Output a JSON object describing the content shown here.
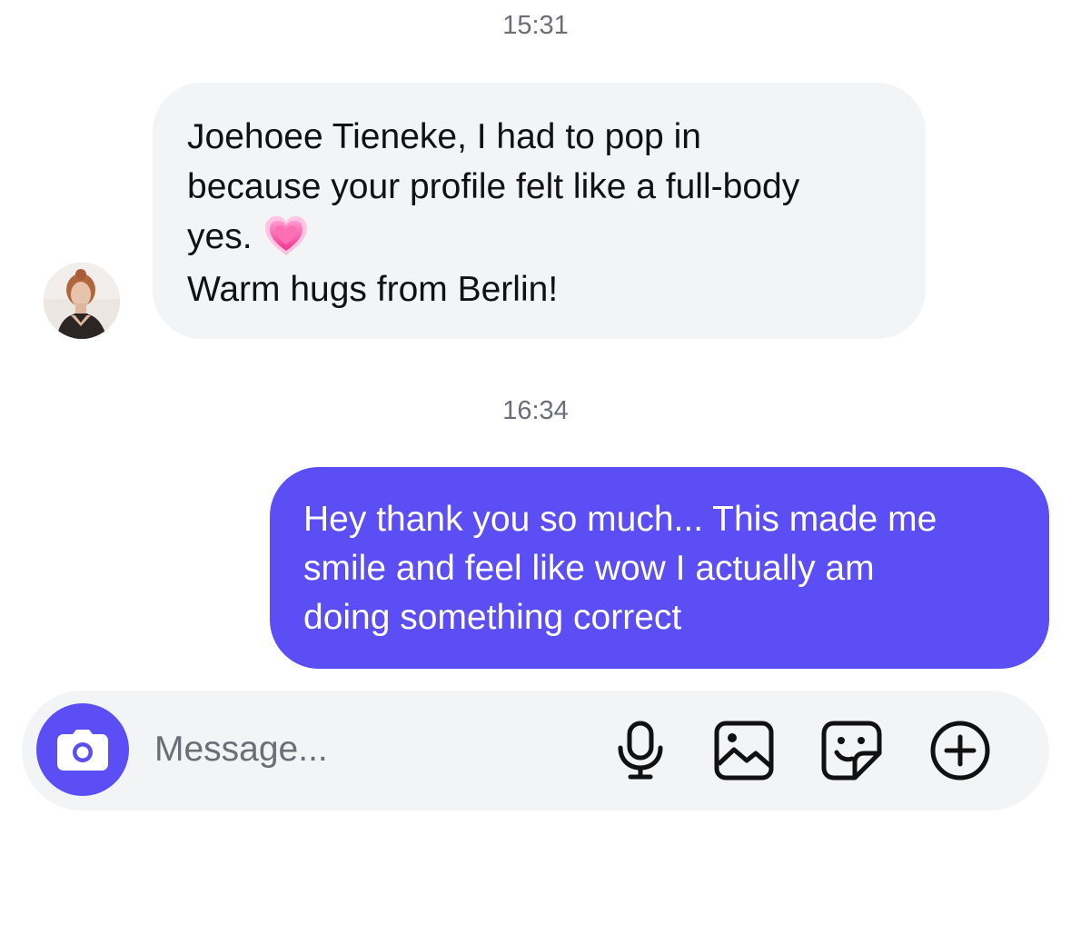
{
  "conversation": {
    "messages": [
      {
        "timestamp": "15:31",
        "direction": "incoming",
        "avatar_icon": "profile-photo-avatar",
        "lines": [
          "Joehoee Tieneke, I had to pop in",
          "because your profile felt like a full-body",
          "yes.",
          "Warm hugs from Berlin!"
        ],
        "emoji": "💗",
        "emoji_icon": "growing-heart-icon"
      },
      {
        "timestamp": "16:34",
        "direction": "outgoing",
        "lines": [
          "Hey thank you so much... This made me",
          "smile and feel like wow I actually am",
          "doing something correct"
        ]
      }
    ]
  },
  "composer": {
    "placeholder": "Message...",
    "value": "",
    "buttons": {
      "camera": "camera-icon",
      "mic": "microphone-icon",
      "gallery": "image-gallery-icon",
      "sticker": "sticker-icon",
      "more": "plus-circle-icon"
    }
  },
  "colors": {
    "accent": "#5b4ef5",
    "incoming_bubble": "#f3f4f6",
    "composer_background": "#f3f4f6",
    "timestamp_text": "#6b6e76",
    "placeholder_text": "#6b6e76",
    "outgoing_text": "#ffffff"
  }
}
